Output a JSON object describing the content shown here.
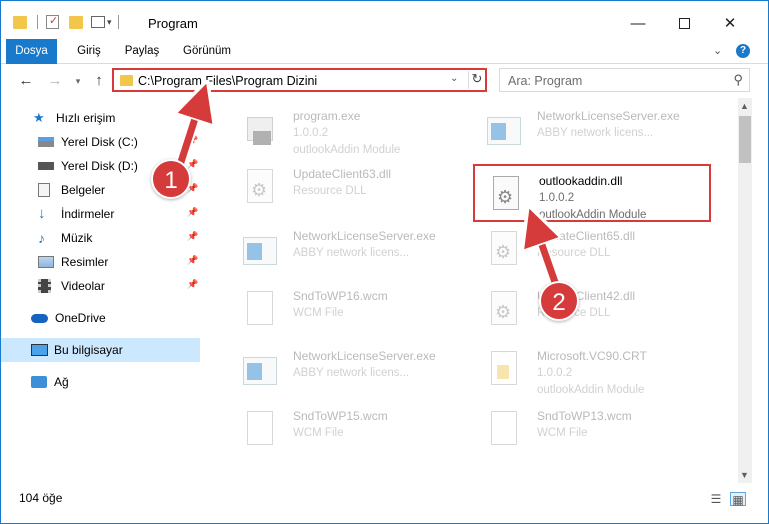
{
  "window": {
    "title": "Program"
  },
  "ribbon": {
    "tabs": [
      "Dosya",
      "Giriş",
      "Paylaş",
      "Görünüm"
    ]
  },
  "address": {
    "path": "C:\\Program Files\\Program Dizini"
  },
  "search": {
    "placeholder": "Ara: Program"
  },
  "sidebar": {
    "quick_access": "Hızlı erişim",
    "items": [
      "Yerel Disk (C:)",
      "Yerel Disk (D:)",
      "Belgeler",
      "İndirmeler",
      "Müzik",
      "Resimler",
      "Videolar"
    ],
    "onedrive": "OneDrive",
    "this_pc": "Bu bilgisayar",
    "network": "Ağ"
  },
  "files": [
    {
      "name": "program.exe",
      "l2": "1.0.0.2",
      "l3": "outlookAddin Module",
      "icon": "exe-icon"
    },
    {
      "name": "NetworkLicenseServer.exe",
      "l2": "ABBY network licens...",
      "l3": "",
      "icon": "app-window-icon"
    },
    {
      "name": "UpdateClient63.dll",
      "l2": "Resource DLL",
      "l3": "",
      "icon": "dll-gear-icon"
    },
    {
      "name": "outlookaddin.dll",
      "l2": "1.0.0.2",
      "l3": "outlookAddin Module",
      "icon": "dll-gear-icon"
    },
    {
      "name": "NetworkLicenseServer.exe",
      "l2": "ABBY network licens...",
      "l3": "",
      "icon": "app-window-icon"
    },
    {
      "name": "UpdateClient65.dll",
      "l2": "Resource DLL",
      "l3": "",
      "icon": "dll-gear-icon"
    },
    {
      "name": "SndToWP16.wcm",
      "l2": "WCM File",
      "l3": "",
      "icon": "blank-file-icon"
    },
    {
      "name": "UpdateClient42.dll",
      "l2": "Resource DLL",
      "l3": "",
      "icon": "dll-gear-icon"
    },
    {
      "name": "NetworkLicenseServer.exe",
      "l2": "ABBY network licens...",
      "l3": "",
      "icon": "app-window-icon"
    },
    {
      "name": "Microsoft.VC90.CRT",
      "l2": "1.0.0.2",
      "l3": "outlookAddin Module",
      "icon": "folder-doc-icon"
    },
    {
      "name": "SndToWP15.wcm",
      "l2": "WCM File",
      "l3": "",
      "icon": "blank-file-icon"
    },
    {
      "name": "SndToWP13.wcm",
      "l2": "WCM File",
      "l3": "",
      "icon": "blank-file-icon"
    }
  ],
  "status": {
    "count": "104 öğe"
  },
  "annotations": {
    "step1": "1",
    "step2": "2"
  },
  "colors": {
    "accent": "#1979ca",
    "highlight": "#d63b3b",
    "selected": "#cce8ff"
  }
}
